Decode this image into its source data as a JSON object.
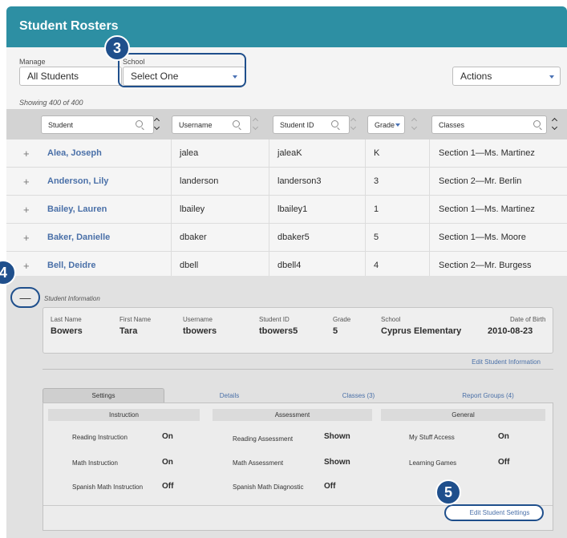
{
  "header": {
    "title": "Student Rosters"
  },
  "controls": {
    "manage_label": "Manage",
    "manage_value": "All Students",
    "school_label": "School",
    "school_value": "Select One",
    "actions_value": "Actions"
  },
  "showing_text": "Showing 400 of 400",
  "columns": {
    "student": "Student",
    "username": "Username",
    "student_id": "Student ID",
    "grade": "Grade",
    "classes": "Classes"
  },
  "rows": [
    {
      "name": "Alea, Joseph",
      "username": "jalea",
      "student_id": "jaleaK",
      "grade": "K",
      "classes": "Section 1—Ms. Martinez"
    },
    {
      "name": "Anderson, Lily",
      "username": "landerson",
      "student_id": "landerson3",
      "grade": "3",
      "classes": "Section 2—Mr. Berlin"
    },
    {
      "name": "Bailey, Lauren",
      "username": "lbailey",
      "student_id": "lbailey1",
      "grade": "1",
      "classes": "Section 1—Ms. Martinez"
    },
    {
      "name": "Baker, Danielle",
      "username": "dbaker",
      "student_id": "dbaker5",
      "grade": "5",
      "classes": "Section 1—Ms. Moore"
    },
    {
      "name": "Bell, Deidre",
      "username": "dbell",
      "student_id": "dbell4",
      "grade": "4",
      "classes": "Section 2—Mr. Burgess"
    }
  ],
  "expanded": {
    "toggle": "—",
    "section_label": "Student Information",
    "fields": {
      "last_name_label": "Last Name",
      "last_name": "Bowers",
      "first_name_label": "First Name",
      "first_name": "Tara",
      "username_label": "Username",
      "username": "tbowers",
      "student_id_label": "Student ID",
      "student_id": "tbowers5",
      "grade_label": "Grade",
      "grade": "5",
      "school_label": "School",
      "school": "Cyprus Elementary",
      "dob_label": "Date of Birth",
      "dob": "2010-08-23"
    },
    "edit_info": "Edit Student Information",
    "tabs": [
      "Settings",
      "Details",
      "Classes (3)",
      "Report Groups (4)"
    ],
    "sections": [
      "Instruction",
      "Assessment",
      "General"
    ],
    "settings": {
      "reading_instruction": "Reading Instruction",
      "reading_instruction_v": "On",
      "math_instruction": "Math Instruction",
      "math_instruction_v": "On",
      "spanish_math_instruction": "Spanish Math Instruction",
      "spanish_math_instruction_v": "Off",
      "reading_assessment": "Reading Assessment",
      "reading_assessment_v": "Shown",
      "math_assessment": "Math Assessment",
      "math_assessment_v": "Shown",
      "spanish_math_diagnostic": "Spanish Math Diagnostic",
      "spanish_math_diagnostic_v": "Off",
      "my_stuff_access": "My Stuff Access",
      "my_stuff_access_v": "On",
      "learning_games": "Learning Games",
      "learning_games_v": "Off"
    },
    "edit_settings": "Edit Student Settings"
  },
  "callouts": [
    "3",
    "4",
    "5"
  ],
  "colors": {
    "header_teal": "#2d8fa3",
    "callout_navy": "#1f4f8c",
    "link_blue": "#4a70a8"
  }
}
